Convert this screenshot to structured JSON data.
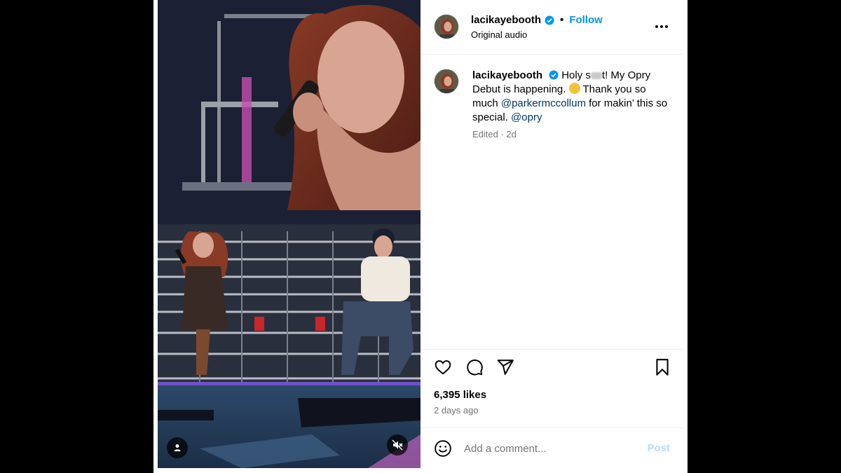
{
  "post": {
    "username": "lacikayebooth",
    "verified": true,
    "follow_label": "Follow",
    "separator": "•",
    "audio": "Original audio",
    "caption_parts": {
      "start": "Holy s",
      "after_censor": "t! My Opry Debut is happening.",
      "thanks": "Thank you so much",
      "mention1": "@parkermccollum",
      "middle": "for makin’ this so special.",
      "mention2": "@opry"
    },
    "caption_meta": "Edited · 2d",
    "likes": "6,395 likes",
    "time_ago": "2 days ago",
    "comment_placeholder": "Add a comment...",
    "post_label": "Post"
  },
  "icons": {
    "more": "more-options-icon",
    "like": "heart-icon",
    "comment": "comment-icon",
    "share": "share-icon",
    "save": "bookmark-icon",
    "emoji": "emoji-icon",
    "tagged": "user-tag-icon",
    "mute": "muted-speaker-icon"
  },
  "colors": {
    "link": "#0095f6",
    "mention": "#00376b",
    "muted_text": "#737373",
    "verified_badge": "#0095f6",
    "post_disabled": "#b3dbff"
  }
}
